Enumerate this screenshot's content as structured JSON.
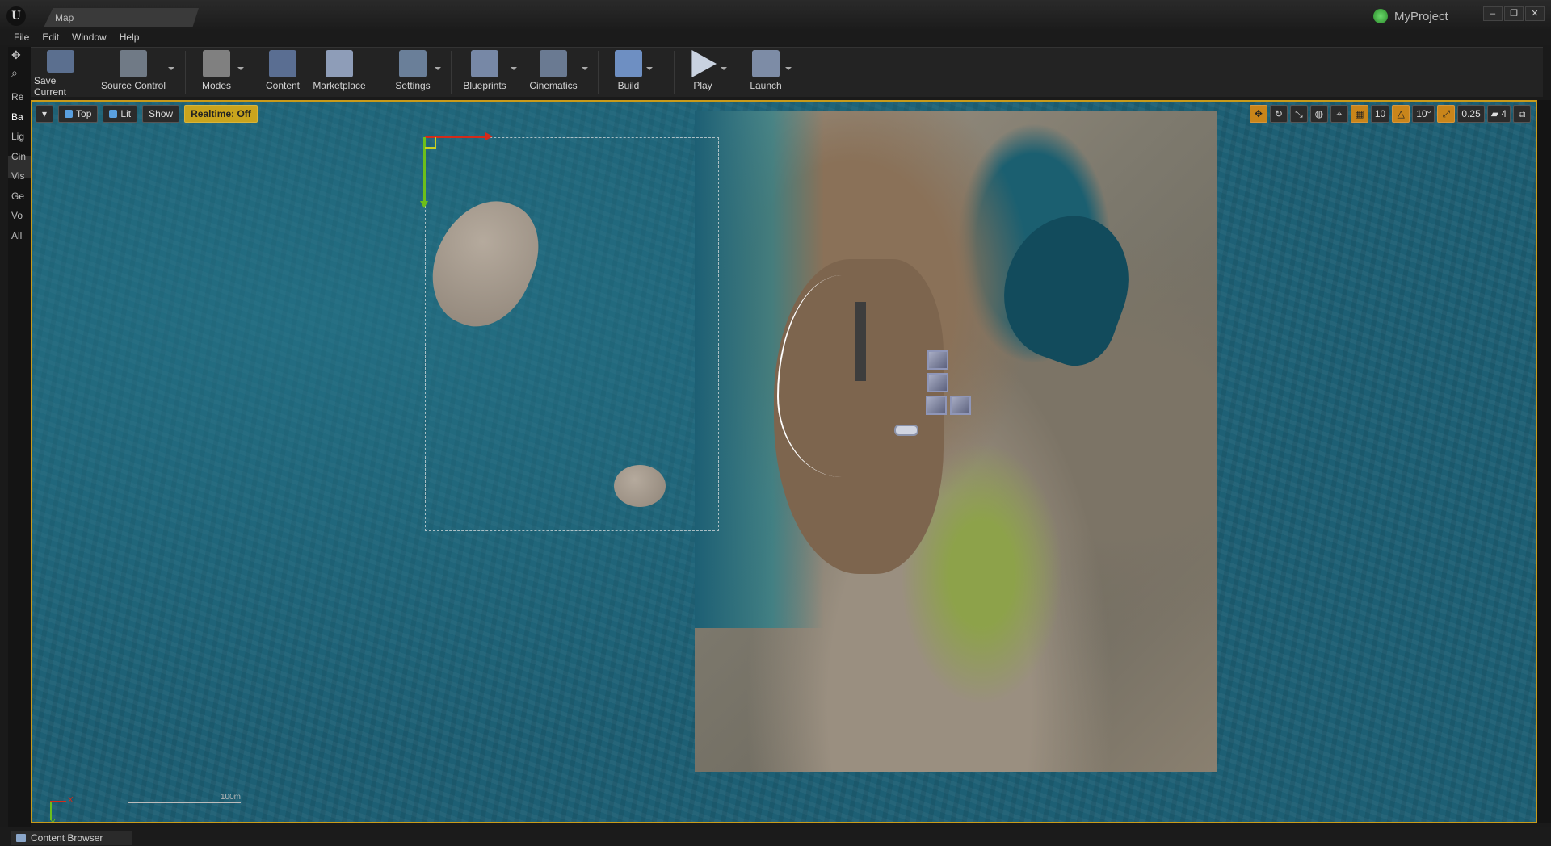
{
  "window": {
    "tab_title": "Map",
    "project_name": "MyProject",
    "controls": [
      "–",
      "❐",
      "✕"
    ]
  },
  "menu": {
    "items": [
      "File",
      "Edit",
      "Window",
      "Help"
    ]
  },
  "left_panel": {
    "items": [
      "Re",
      "Ba",
      "Lig",
      "Cin",
      "Vis",
      "Ge",
      "Vo",
      "All"
    ],
    "selected": "Ba"
  },
  "toolbar": {
    "buttons": [
      {
        "label": "Save Current",
        "icon": "save-icon",
        "color": "#5b6f8f"
      },
      {
        "label": "Source Control",
        "icon": "source-control-icon",
        "color": "#707a86"
      },
      {
        "label": "Modes",
        "icon": "modes-icon",
        "color": "#808080"
      },
      {
        "label": "Content",
        "icon": "content-icon",
        "color": "#5a6e92"
      },
      {
        "label": "Marketplace",
        "icon": "marketplace-icon",
        "color": "#8e9db8"
      },
      {
        "label": "Settings",
        "icon": "settings-icon",
        "color": "#6a7f99"
      },
      {
        "label": "Blueprints",
        "icon": "blueprints-icon",
        "color": "#7788a6"
      },
      {
        "label": "Cinematics",
        "icon": "cinematics-icon",
        "color": "#6a7a92"
      },
      {
        "label": "Build",
        "icon": "build-icon",
        "color": "#6e8fc2"
      },
      {
        "label": "Play",
        "icon": "play-icon",
        "color": "#c9d2e0"
      },
      {
        "label": "Launch",
        "icon": "launch-icon",
        "color": "#7d8ca6"
      }
    ]
  },
  "viewport": {
    "view_menu": "▾",
    "perspective": "Top",
    "view_mode": "Lit",
    "show": "Show",
    "realtime": "Realtime: Off",
    "right_controls": {
      "grid_snap": "10",
      "rotation_snap": "10°",
      "scale_snap": "0.25",
      "camera_speed": "4"
    },
    "scale_label": "100m",
    "axis_x": "X",
    "axis_y": "Y"
  },
  "bottom": {
    "content_browser": "Content Browser"
  },
  "colors": {
    "selection_border": "#c89a1a",
    "realtime_bg": "#c9a41d",
    "water": "#1d5f74"
  }
}
